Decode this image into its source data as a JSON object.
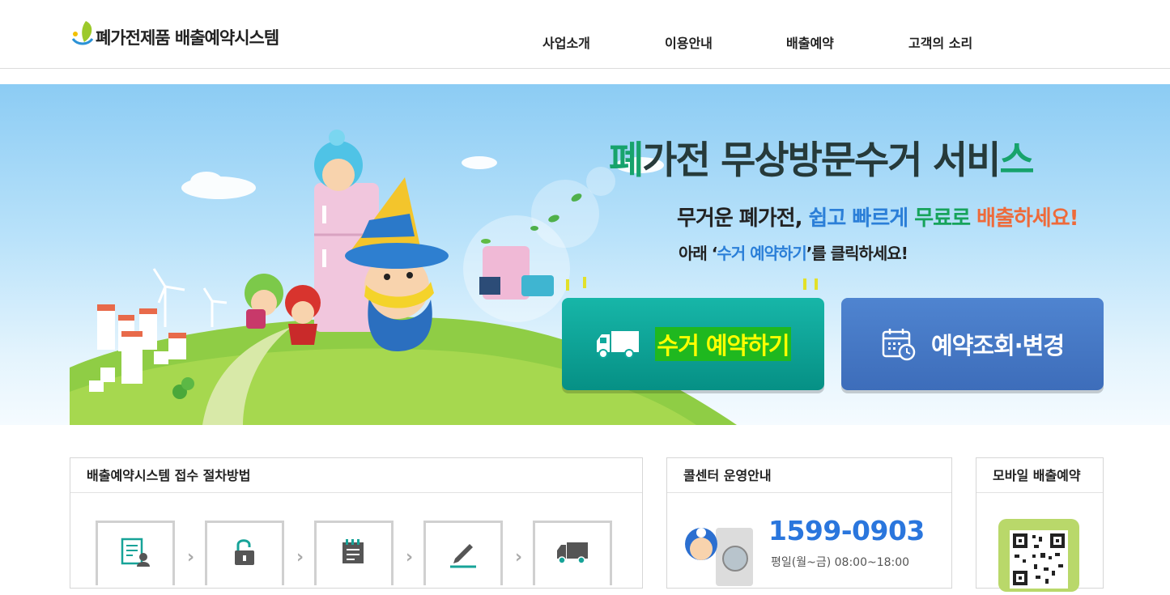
{
  "header": {
    "logo_text": "폐가전제품 배출예약시스템",
    "nav": [
      "사업소개",
      "이용안내",
      "배출예약",
      "고객의 소리"
    ]
  },
  "hero": {
    "title_first": "폐",
    "title_middle": "가전 무상방문수거 서비",
    "title_last": "스",
    "sub1": {
      "part1": "무거운 폐가전, ",
      "part2": "쉽고 빠르게 ",
      "part3": "무료로 ",
      "part4": "배출하세요!"
    },
    "sub2": {
      "part1": "아래 ‘",
      "part2": "수거 예약하기",
      "part3": "’를 클릭하세요!"
    },
    "collect_button": "수거 예약하기",
    "inquiry_button": "예약조회·변경"
  },
  "panels": {
    "procedure_title": "배출예약시스템 접수 절차방법",
    "callcenter_title": "콜센터 운영안내",
    "callcenter_phone": "1599-0903",
    "callcenter_hours": "평일(월~금)  08:00~18:00",
    "mobile_title": "모바일 배출예약"
  },
  "colors": {
    "collect_button": "#0fa99c",
    "inquiry_button": "#4a7bc8",
    "phone": "#2a76dd",
    "title_accent": "#17a36c"
  }
}
